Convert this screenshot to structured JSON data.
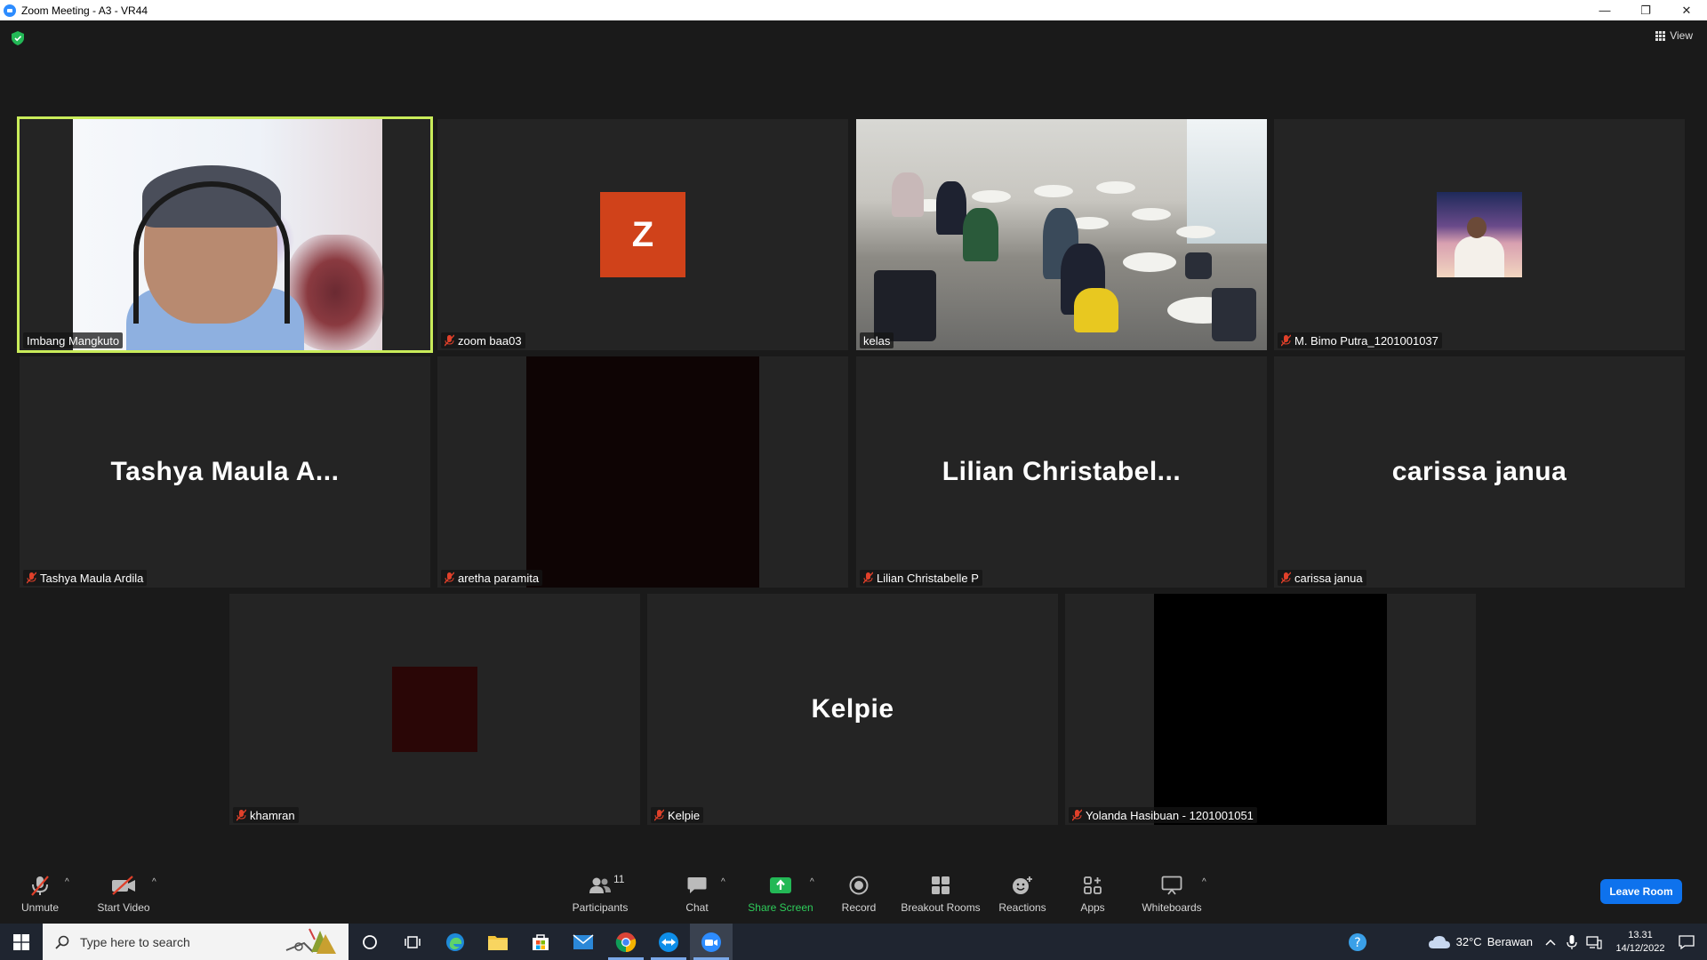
{
  "window": {
    "title": "Zoom Meeting - A3 - VR44",
    "minimize": "—",
    "restore": "❐",
    "close": "✕"
  },
  "meeting": {
    "view_label": "View"
  },
  "tiles": {
    "t1": {
      "name": "Imbang Mangkuto"
    },
    "t2": {
      "name": "zoom baa03",
      "avatar_letter": "Z"
    },
    "t3": {
      "name": "kelas"
    },
    "t4": {
      "name": "M. Bimo Putra_1201001037"
    },
    "t5": {
      "name": "Tashya Maula Ardila",
      "display": "Tashya Maula A..."
    },
    "t6": {
      "name": "aretha paramita"
    },
    "t7": {
      "name": "Lilian Christabelle P",
      "display": "Lilian Christabel..."
    },
    "t8": {
      "name": "carissa janua",
      "display": "carissa janua"
    },
    "t9": {
      "name": "khamran"
    },
    "t10": {
      "name": "Kelpie",
      "display": "Kelpie"
    },
    "t11": {
      "name": "Yolanda Hasibuan - 1201001051"
    }
  },
  "toolbar": {
    "unmute": "Unmute",
    "start_video": "Start Video",
    "participants": "Participants",
    "participants_count": "11",
    "chat": "Chat",
    "share_screen": "Share Screen",
    "record": "Record",
    "breakout_rooms": "Breakout Rooms",
    "reactions": "Reactions",
    "apps": "Apps",
    "whiteboards": "Whiteboards",
    "leave_room": "Leave Room",
    "caret": "^"
  },
  "taskbar": {
    "search_placeholder": "Type here to search",
    "weather_temp": "32°C",
    "weather_text": "Berawan",
    "time": "13.31",
    "date": "14/12/2022"
  },
  "colors": {
    "active_speaker": "#c9ec5a",
    "avatar_z": "#d0421a",
    "leave_button": "#0e72ed",
    "share_green": "#2ecc5a",
    "mute_red": "#e0402a"
  }
}
